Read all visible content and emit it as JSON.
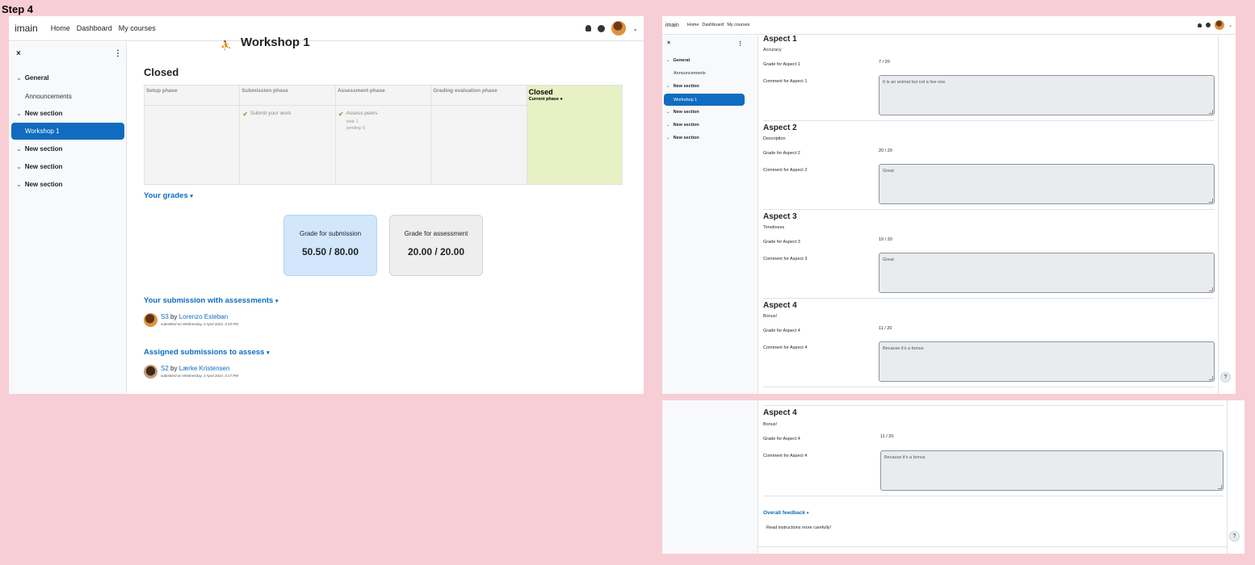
{
  "step_label": "Step 4",
  "navbar": {
    "brand": "imain",
    "links": [
      "Home",
      "Dashboard",
      "My courses"
    ]
  },
  "drawer": {
    "close": "×",
    "sections": [
      {
        "label": "General",
        "activities": [
          "Announcements"
        ]
      },
      {
        "label": "New section",
        "activities": [
          "Workshop 1"
        ]
      },
      {
        "label": "New section",
        "activities": []
      },
      {
        "label": "New section",
        "activities": []
      },
      {
        "label": "New section",
        "activities": []
      }
    ]
  },
  "workshop": {
    "title": "Workshop 1",
    "phase_heading": "Closed",
    "phases": [
      "Setup phase",
      "Submission phase",
      "Assessment phase",
      "Grading evaluation phase",
      "Closed"
    ],
    "current_phase_label": "Current phase",
    "submit_task": "Submit your work",
    "assess_task": "Assess peers",
    "assess_total": "total: 1",
    "assess_pending": "pending: 0",
    "your_grades": "Your grades",
    "grade_submission_label": "Grade for submission",
    "grade_submission_value": "50.50 / 80.00",
    "grade_assessment_label": "Grade for assessment",
    "grade_assessment_value": "20.00 / 20.00",
    "your_submission_heading": "Your submission with assessments",
    "sub1_title": "S3",
    "sub1_by": "by",
    "sub1_author": "Lorenzo Esteban",
    "sub1_date": "submitted on Wednesday, 3 April 2024, 3:19 PM",
    "assigned_heading": "Assigned submissions to assess",
    "sub2_title": "S2",
    "sub2_by": "by",
    "sub2_author": "Lærke Kristensen",
    "sub2_date": "submitted on Wednesday, 3 April 2024, 3:17 PM"
  },
  "aspects": [
    {
      "title": "Aspect 1",
      "desc": "Accuracy",
      "grade_label": "Grade for Aspect 1",
      "grade": "7 / 20",
      "comment_label": "Comment for Aspect 1",
      "comment": "It is an animal but not a live one"
    },
    {
      "title": "Aspect 2",
      "desc": "Description",
      "grade_label": "Grade for Aspect 2",
      "grade": "20 / 20",
      "comment_label": "Comment for Aspect 2",
      "comment": "Great"
    },
    {
      "title": "Aspect 3",
      "desc": "Timeliness",
      "grade_label": "Grade for Aspect 3",
      "grade": "19 / 20",
      "comment_label": "Comment for Aspect 3",
      "comment": "Great"
    },
    {
      "title": "Aspect 4",
      "desc": "Bonus!",
      "grade_label": "Grade for Aspect 4",
      "grade": "11 / 20",
      "comment_label": "Comment for Aspect 4",
      "comment": "Because it's a bonus"
    }
  ],
  "overall_feedback": {
    "heading": "Overall feedback",
    "text": "Read instructions more carefully!"
  },
  "help": "?"
}
